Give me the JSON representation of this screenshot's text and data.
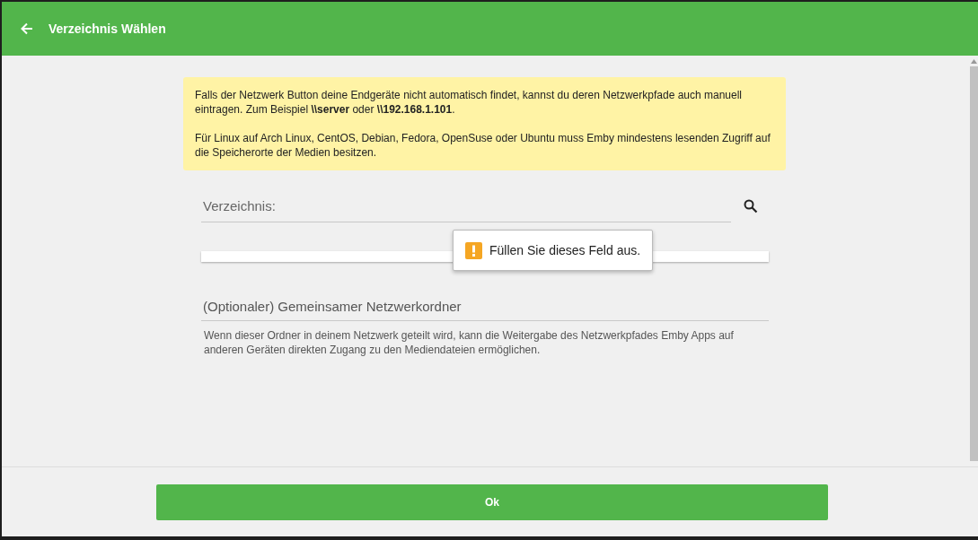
{
  "header": {
    "title": "Verzeichnis Wählen"
  },
  "notice": {
    "paragraphs": [
      "Falls der Netzwerk Button deine Endgeräte nicht automatisch findet, kannst du deren Netzwerkpfade auch manuell eintragen. Zum Beispiel **\\\\server** oder **\\\\192.168.1.101**.",
      "Für Linux auf Arch Linux, CentOS, Debian, Fedora, OpenSuse oder Ubuntu muss Emby mindestens lesenden Zugriff auf die Speicherorte der Medien besitzen."
    ]
  },
  "directory_field": {
    "placeholder": "Verzeichnis:"
  },
  "validation_tooltip": {
    "text": "Füllen Sie dieses Feld aus."
  },
  "network_share_field": {
    "placeholder": "(Optionaler) Gemeinsamer Netzwerkordner",
    "help": "Wenn dieser Ordner in deinem Netzwerk geteilt wird, kann die Weitergabe des Netzwerkpfades Emby Apps auf anderen Geräten direkten Zugang zu den Mediendateien ermöglichen."
  },
  "ok_button": {
    "label": "Ok"
  }
}
